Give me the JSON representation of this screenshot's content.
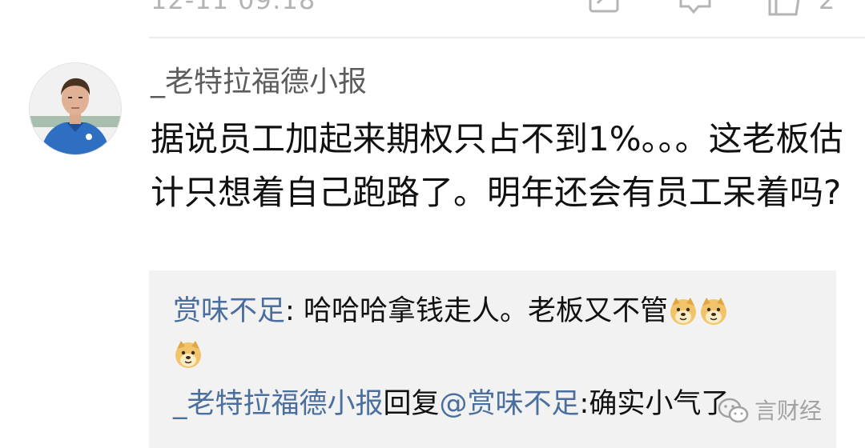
{
  "previous_comment": {
    "time": "12-11 09:18",
    "like_count": "2",
    "share_icon": "share-icon",
    "comment_icon": "comment-icon",
    "like_icon": "thumbs-up-icon"
  },
  "comment": {
    "username": "_老特拉福德小报",
    "text": "据说员工加起来期权只占不到1%。。。这老板估计只想着自己跑路了。明年还会有员工呆着吗?"
  },
  "replies": [
    {
      "author": "赏味不足",
      "separator": ": ",
      "text": "哈哈哈拿钱走人。老板又不管",
      "emoji": "doge-emoji"
    },
    {
      "author": "_老特拉福德小报",
      "verb": "回复",
      "mention": "@赏味不足",
      "separator": ":",
      "text": "确实小气了"
    }
  ],
  "watermark": {
    "text": "言财经",
    "icon": "wechat-icon"
  },
  "colors": {
    "link": "#4a6f9e",
    "reply_background": "#f2f2f2",
    "meta_gray": "#b4b4b4"
  }
}
